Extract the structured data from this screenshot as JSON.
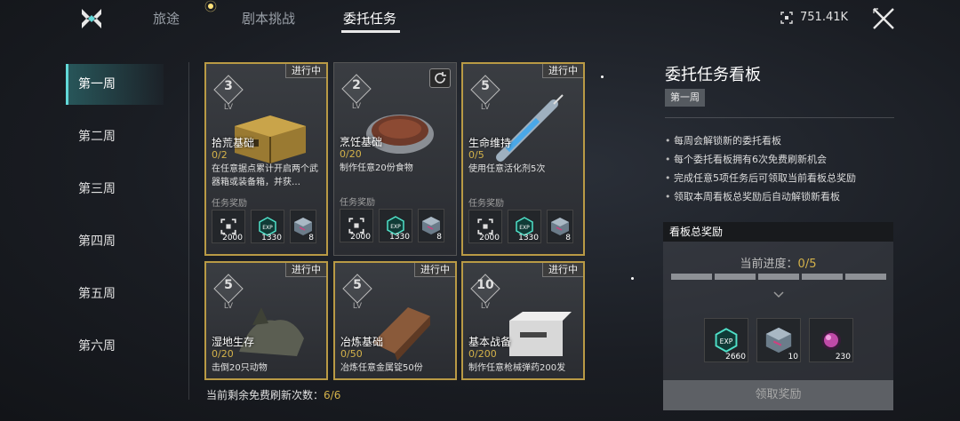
{
  "nav": {
    "tabs": [
      {
        "label": "旅途"
      },
      {
        "label": "剧本挑战"
      },
      {
        "label": "委托任务"
      }
    ],
    "currency_value": "751.41K"
  },
  "weeks": [
    {
      "label": "第一周"
    },
    {
      "label": "第二周"
    },
    {
      "label": "第三周"
    },
    {
      "label": "第四周"
    },
    {
      "label": "第五周"
    },
    {
      "label": "第六周"
    }
  ],
  "cards": [
    {
      "level": "3",
      "lv": "LV",
      "status": "进行中",
      "name": "拾荒基础",
      "progress": "0/2",
      "desc": "在任意据点累计开启两个武器箱或装备箱，并获…",
      "reward_label": "任务奖励",
      "rewards": [
        "2000",
        "1330",
        "8"
      ]
    },
    {
      "level": "2",
      "lv": "LV",
      "status": "",
      "name": "烹饪基础",
      "progress": "0/20",
      "desc": "制作任意20份食物",
      "reward_label": "任务奖励",
      "rewards": [
        "2000",
        "1330",
        "8"
      ]
    },
    {
      "level": "5",
      "lv": "LV",
      "status": "进行中",
      "name": "生命维持",
      "progress": "0/5",
      "desc": "使用任意活化剂5次",
      "reward_label": "任务奖励",
      "rewards": [
        "2000",
        "1330",
        "8"
      ]
    },
    {
      "level": "5",
      "lv": "LV",
      "status": "进行中",
      "name": "湿地生存",
      "progress": "0/20",
      "desc": "击倒20只动物",
      "reward_label": "",
      "rewards": []
    },
    {
      "level": "5",
      "lv": "LV",
      "status": "进行中",
      "name": "冶炼基础",
      "progress": "0/50",
      "desc": "冶炼任意金属锭50份",
      "reward_label": "",
      "rewards": []
    },
    {
      "level": "10",
      "lv": "LV",
      "status": "进行中",
      "name": "基本战备",
      "progress": "0/200",
      "desc": "制作任意枪械弹药200发",
      "reward_label": "",
      "rewards": []
    }
  ],
  "free_refresh": {
    "label": "当前剩余免费刷新次数：",
    "value": "6/6"
  },
  "board": {
    "title": "委托任务看板",
    "week_badge": "第一周",
    "rules": [
      "每周会解锁新的委托看板",
      "每个委托看板拥有6次免费刷新机会",
      "完成任意5项任务后可领取当前看板总奖励",
      "领取本周看板总奖励后自动解锁新看板"
    ],
    "total_reward_title": "看板总奖励",
    "progress_label": "当前进度：",
    "progress_value": "0/5",
    "progress_fraction": 0,
    "rewards": [
      "2660",
      "10",
      "230"
    ],
    "claim_label": "领取奖励"
  },
  "colors": {
    "accent_gold": "#d4b24a",
    "accent_teal": "#62d8d8",
    "exp_green": "#4fe0c8"
  },
  "icons": {
    "reward1": "target-frame-icon",
    "reward2": "exp-icon",
    "reward3": "crystal-cube-icon",
    "reward4": "pink-orb-icon"
  }
}
